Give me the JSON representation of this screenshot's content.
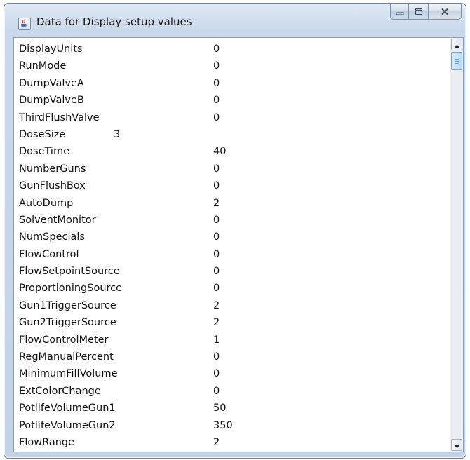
{
  "window": {
    "title": "Data for Display setup values"
  },
  "icons": {
    "app": "java-app-icon",
    "minimize": "minimize-icon",
    "maximize": "maximize-icon",
    "close": "close-icon",
    "scroll_up": "arrow-up-icon",
    "scroll_down": "arrow-down-icon"
  },
  "list": [
    {
      "key": "DisplayUnits",
      "value": "0"
    },
    {
      "key": "RunMode",
      "value": "0"
    },
    {
      "key": "DumpValveA",
      "value": "0"
    },
    {
      "key": "DumpValveB",
      "value": "0"
    },
    {
      "key": "ThirdFlushValve",
      "value": "0"
    },
    {
      "key": "DoseSize",
      "value": "3"
    },
    {
      "key": "DoseTime",
      "value": "40"
    },
    {
      "key": "NumberGuns",
      "value": "0"
    },
    {
      "key": "GunFlushBox",
      "value": "0"
    },
    {
      "key": "AutoDump",
      "value": "2"
    },
    {
      "key": "SolventMonitor",
      "value": "0"
    },
    {
      "key": "NumSpecials",
      "value": "0"
    },
    {
      "key": "FlowControl",
      "value": "0"
    },
    {
      "key": "FlowSetpointSource",
      "value": "0"
    },
    {
      "key": "ProportioningSource",
      "value": "0"
    },
    {
      "key": "Gun1TriggerSource",
      "value": "2"
    },
    {
      "key": "Gun2TriggerSource",
      "value": "2"
    },
    {
      "key": "FlowControlMeter",
      "value": "1"
    },
    {
      "key": "RegManualPercent",
      "value": "0"
    },
    {
      "key": "MinimumFillVolume",
      "value": "0"
    },
    {
      "key": "ExtColorChange",
      "value": "0"
    },
    {
      "key": "PotlifeVolumeGun1",
      "value": "50"
    },
    {
      "key": "PotlifeVolumeGun2",
      "value": "350"
    },
    {
      "key": "FlowRange",
      "value": "2"
    }
  ],
  "colors": {
    "titlebar": "#c9d8ea",
    "text": "#111111",
    "thumb": "#b9dbf7"
  }
}
